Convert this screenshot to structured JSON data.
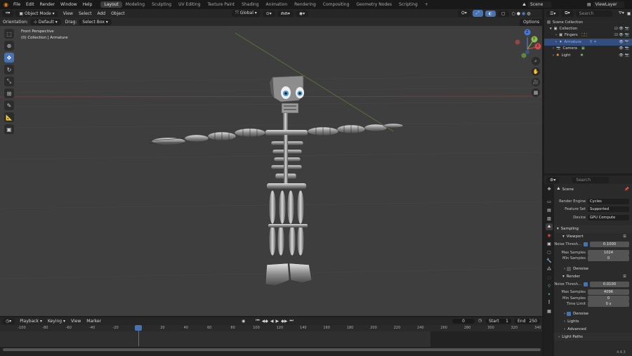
{
  "menu": [
    "File",
    "Edit",
    "Render",
    "Window",
    "Help"
  ],
  "workspaces": [
    "Layout",
    "Modeling",
    "Sculpting",
    "UV Editing",
    "Texture Paint",
    "Shading",
    "Animation",
    "Rendering",
    "Compositing",
    "Geometry Nodes",
    "Scripting"
  ],
  "active_workspace": "Layout",
  "add_tab": "+",
  "scene_name": "Scene",
  "view_layer": "ViewLayer",
  "viewport_header": {
    "mode": "Object Mode",
    "menus": [
      "View",
      "Select",
      "Add",
      "Object"
    ],
    "transform": "Global"
  },
  "viewport_sub": {
    "orientation_label": "Orientation:",
    "orientation": "Default",
    "drag_label": "Drag:",
    "drag": "Select Box",
    "options": "Options"
  },
  "viewport": {
    "view_name": "Front Perspective",
    "collection_info": "(0) Collection | Armature"
  },
  "gizmo": {
    "x": "X",
    "y": "Y",
    "z": "Z"
  },
  "timeline": {
    "menus": [
      "Playback",
      "Keying",
      "View",
      "Marker"
    ],
    "current_frame": "0",
    "start_label": "Start",
    "start": "1",
    "end_label": "End",
    "end": "250",
    "ruler": [
      "-100",
      "-80",
      "-60",
      "-40",
      "-20",
      "0",
      "20",
      "40",
      "60",
      "80",
      "100",
      "120",
      "140",
      "160",
      "180",
      "200",
      "220",
      "240",
      "260",
      "280",
      "300",
      "320",
      "340"
    ]
  },
  "outliner": {
    "search_placeholder": "Search",
    "items": [
      {
        "label": "Scene Collection"
      },
      {
        "label": "Collection"
      },
      {
        "label": "Fingers"
      },
      {
        "label": "Armature"
      },
      {
        "label": "Camera"
      },
      {
        "label": "Light"
      }
    ]
  },
  "properties": {
    "search_placeholder": "Search",
    "scene": "Scene",
    "render_engine_label": "Render Engine",
    "render_engine": "Cycles",
    "feature_set_label": "Feature Set",
    "feature_set": "Supported",
    "device_label": "Device",
    "device": "GPU Compute",
    "sampling": "Sampling",
    "viewport_panel": "Viewport",
    "v_noise_label": "Noise Thresh...",
    "v_noise": "0.1000",
    "v_max_label": "Max Samples",
    "v_max": "1024",
    "v_min_label": "Min Samples",
    "v_min": "0",
    "v_denoise": "Denoise",
    "render_panel": "Render",
    "r_noise_label": "Noise Thresh...",
    "r_noise": "0.0100",
    "r_max_label": "Max Samples",
    "r_max": "4096",
    "r_min_label": "Min Samples",
    "r_min": "0",
    "r_time_label": "Time Limit",
    "r_time": "0 s",
    "r_denoise": "Denoise",
    "lights": "Lights",
    "advanced": "Advanced",
    "light_paths": "Light Paths"
  },
  "version": "4.4.3",
  "colors": {
    "accent": "#4772b3",
    "viewport_bg": "#3e3e3e",
    "playhead": "#4772b3"
  }
}
